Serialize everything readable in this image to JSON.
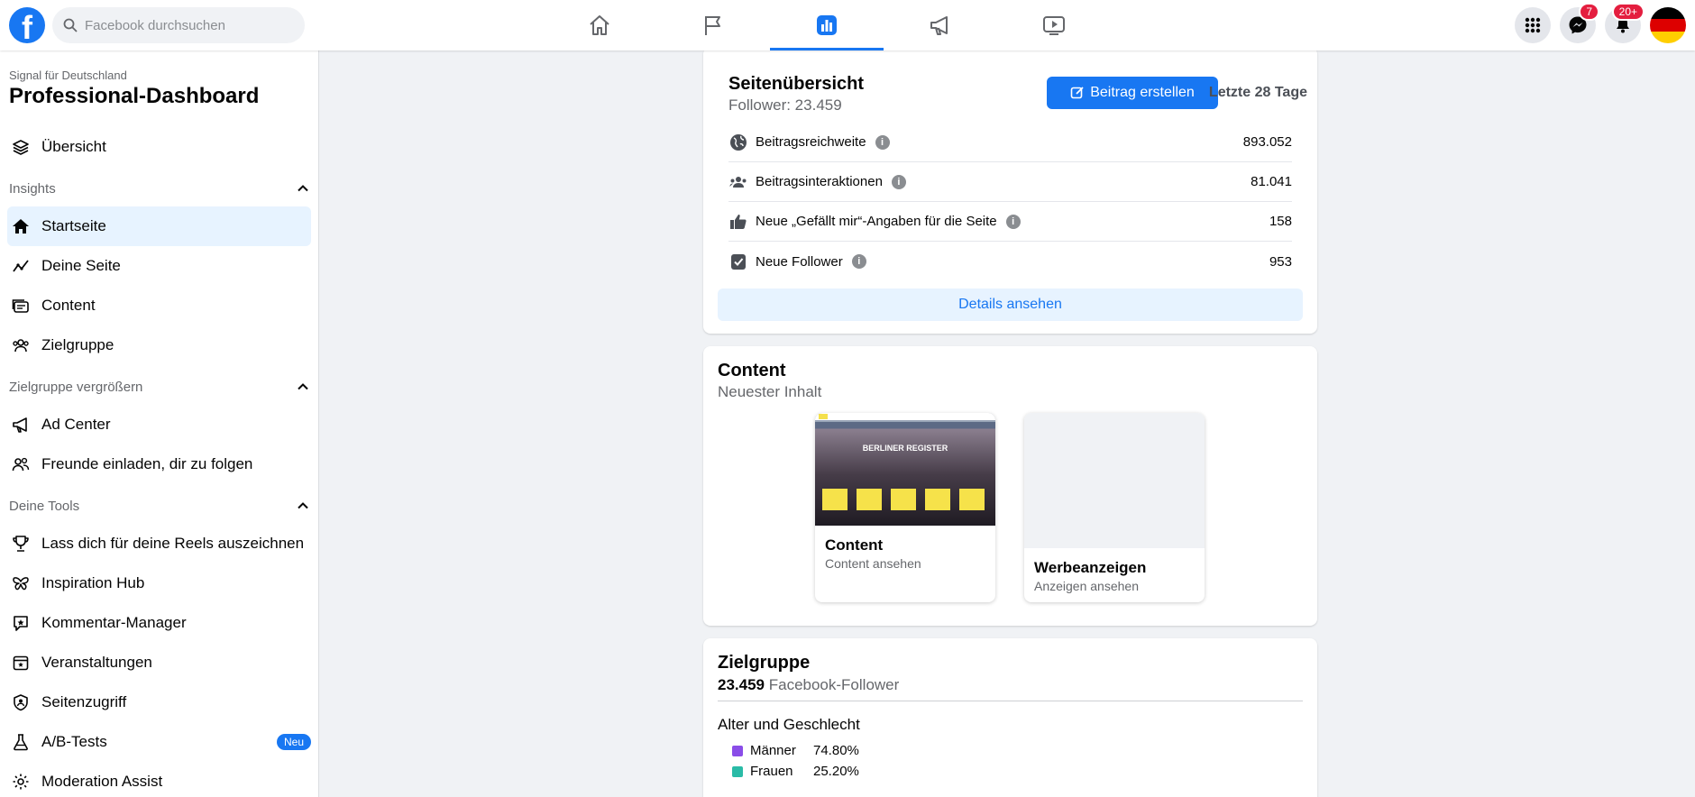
{
  "topbar": {
    "search_placeholder": "Facebook durchsuchen",
    "messenger_badge": "7",
    "notifications_badge": "20+"
  },
  "sidebar": {
    "subtitle": "Signal für Deutschland",
    "title": "Professional-Dashboard",
    "overview": "Übersicht",
    "sections": {
      "insights": "Insights",
      "grow": "Zielgruppe vergrößern",
      "tools": "Deine Tools"
    },
    "insights_items": [
      "Startseite",
      "Deine Seite",
      "Content",
      "Zielgruppe"
    ],
    "grow_items": [
      "Ad Center",
      "Freunde einladen, dir zu folgen"
    ],
    "tools_items": [
      "Lass dich für deine Reels auszeichnen",
      "Inspiration Hub",
      "Kommentar-Manager",
      "Veranstaltungen",
      "Seitenzugriff",
      "A/B-Tests",
      "Moderation Assist"
    ],
    "new_badge": "Neu"
  },
  "overview_card": {
    "title": "Seitenübersicht",
    "followers": "Follower: 23.459",
    "create_button": "Beitrag erstellen",
    "period": "Letzte 28 Tage",
    "metrics": [
      {
        "label": "Beitragsreichweite",
        "value": "893.052",
        "icon": "globe-icon"
      },
      {
        "label": "Beitragsinteraktionen",
        "value": "81.041",
        "icon": "people-icon"
      },
      {
        "label": "Neue „Gefällt mir“-Angaben für die Seite",
        "value": "158",
        "icon": "thumbs-up-icon"
      },
      {
        "label": "Neue Follower",
        "value": "953",
        "icon": "checkbox-icon"
      }
    ],
    "details_button": "Details ansehen"
  },
  "content_card": {
    "title": "Content",
    "subtitle": "Neuester Inhalt",
    "tiles": [
      {
        "title": "Content",
        "subtitle": "Content ansehen",
        "image_text": "BERLINER REGISTER"
      },
      {
        "title": "Werbeanzeigen",
        "subtitle": "Anzeigen ansehen"
      }
    ]
  },
  "audience_card": {
    "title": "Zielgruppe",
    "count": "23.459",
    "count_label": "Facebook-Follower",
    "section_title": "Alter und Geschlecht",
    "legend": [
      {
        "label": "Männer",
        "value": "74.80%",
        "color": "#8a4de8"
      },
      {
        "label": "Frauen",
        "value": "25.20%",
        "color": "#2abba7"
      }
    ]
  },
  "colors": {
    "accent": "#1877f2",
    "active_bg": "#e7f3ff",
    "badge_red": "#e41e3f"
  }
}
